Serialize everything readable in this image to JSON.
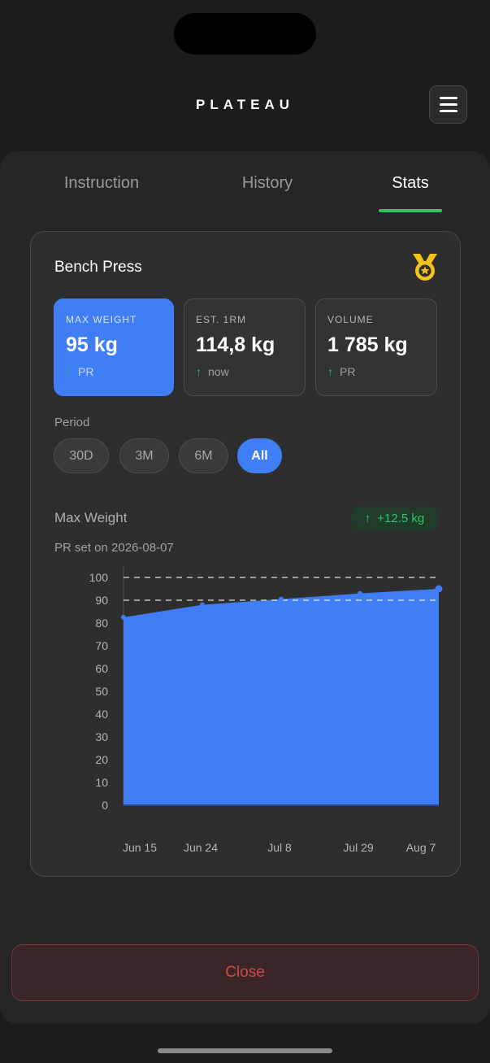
{
  "header": {
    "app_title": "PLATEAU"
  },
  "tabs": [
    {
      "label": "Instruction",
      "active": false
    },
    {
      "label": "History",
      "active": false
    },
    {
      "label": "Stats",
      "active": true
    }
  ],
  "exercise": {
    "name": "Bench Press",
    "badge_icon": "medal-icon"
  },
  "stats": [
    {
      "label": "MAX WEIGHT",
      "value": "95 kg",
      "sub_arrow": "↑",
      "sub": "PR",
      "highlighted": true
    },
    {
      "label": "EST. 1RM",
      "value": "114,8 kg",
      "sub_arrow": "↑",
      "sub": "now",
      "highlighted": false
    },
    {
      "label": "VOLUME",
      "value": "1 785 kg",
      "sub_arrow": "↑",
      "sub": "PR",
      "highlighted": false
    }
  ],
  "period": {
    "label": "Period",
    "options": [
      "30D",
      "3M",
      "6M",
      "All"
    ],
    "selected": "All"
  },
  "chart_section": {
    "title": "Max Weight",
    "delta_arrow": "↑",
    "delta": "+12.5 kg",
    "pr_note": "PR set on 2026-08-07"
  },
  "chart_data": {
    "type": "area",
    "title": "Max Weight",
    "x": [
      "Jun 15",
      "Jun 24",
      "Jul 8",
      "Jul 29",
      "Aug 7"
    ],
    "series": [
      {
        "values": [
          82.5,
          88,
          90.5,
          93,
          95
        ]
      }
    ],
    "xlabel": "",
    "ylabel": "",
    "ylim": [
      0,
      100
    ],
    "yticks": [
      0,
      10,
      20,
      30,
      40,
      50,
      60,
      70,
      80,
      90,
      100
    ],
    "reference_lines": [
      90,
      100
    ],
    "grid": false,
    "colors": {
      "area": "#3f7ef5",
      "reference": "#ffffff"
    }
  },
  "footer": {
    "close_label": "Close"
  },
  "colors": {
    "accent_blue": "#3f7ef5",
    "accent_green": "#2fc56a",
    "danger_red": "#d24a48",
    "medal_gold": "#f2c318"
  }
}
